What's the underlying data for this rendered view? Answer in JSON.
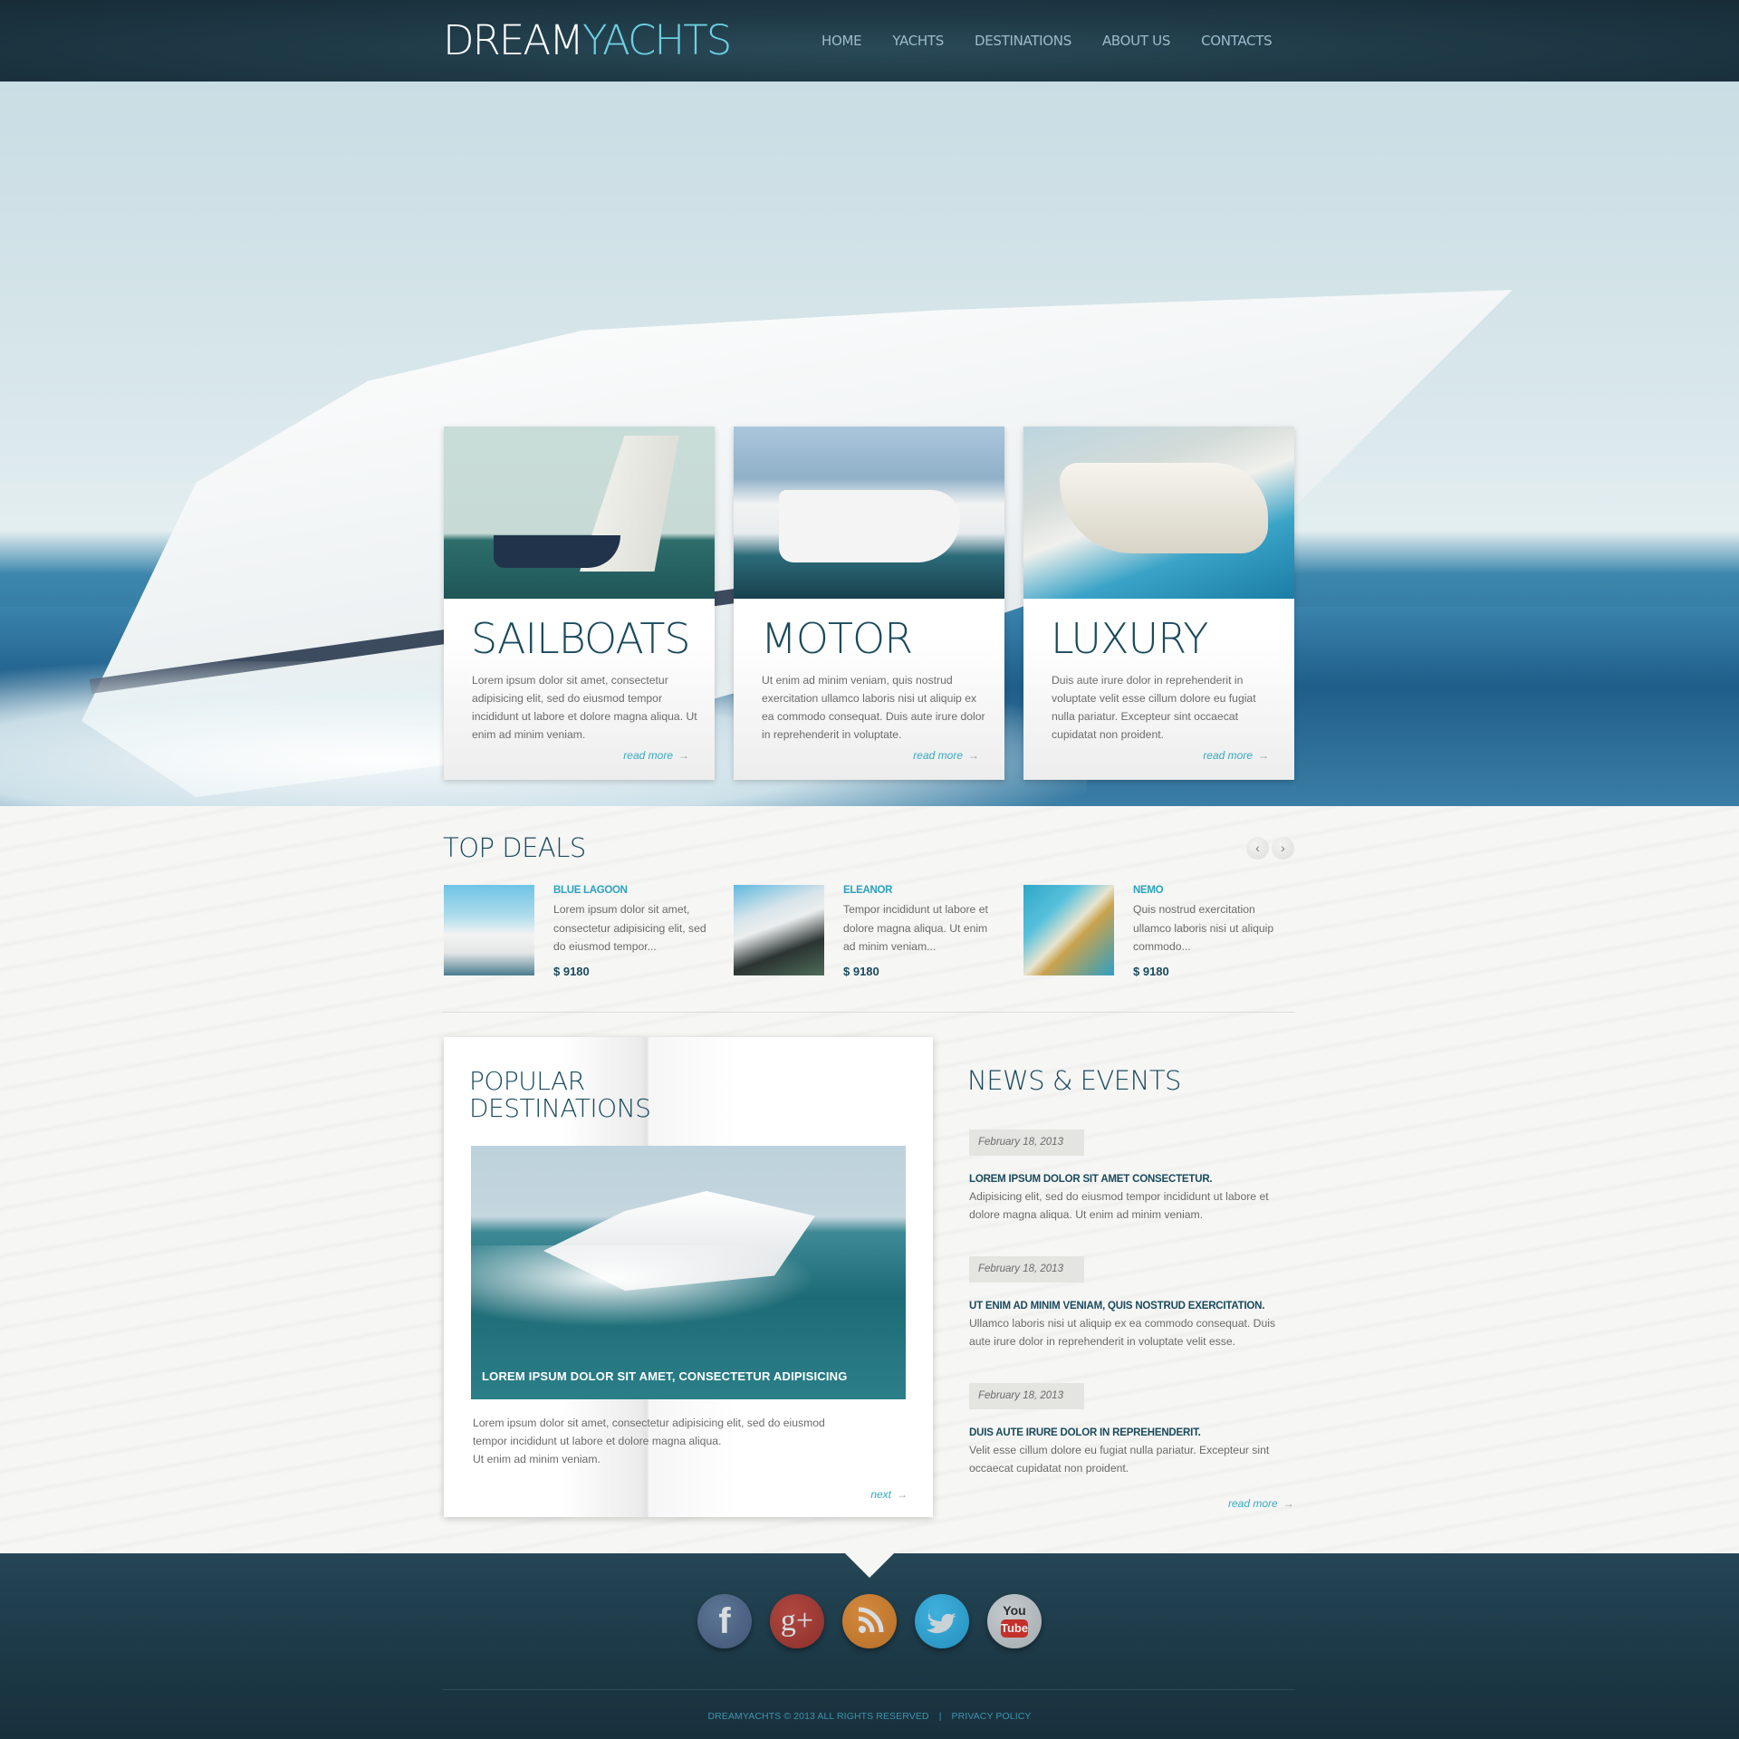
{
  "header": {
    "logo_part1": "DREAM",
    "logo_part2": "YACHTS",
    "nav": [
      "HOME",
      "YACHTS",
      "DESTINATIONS",
      "ABOUT US",
      "CONTACTS"
    ]
  },
  "categories": [
    {
      "title": "SAILBOATS",
      "text": "Lorem ipsum dolor sit amet, consectetur adipisicing elit, sed do eiusmod tempor incididunt ut labore et dolore magna aliqua. Ut enim ad minim veniam.",
      "link": "read more",
      "arrow": "→"
    },
    {
      "title": "MOTOR",
      "text": "Ut enim ad minim veniam, quis nostrud exercitation ullamco laboris nisi ut aliquip ex ea commodo consequat. Duis aute irure dolor in reprehenderit in voluptate.",
      "link": "read more",
      "arrow": "→"
    },
    {
      "title": "LUXURY",
      "text": "Duis aute irure dolor in reprehenderit in voluptate velit esse cillum dolore eu fugiat nulla pariatur. Excepteur sint occaecat cupidatat non proident.",
      "link": "read more",
      "arrow": "→"
    }
  ],
  "top_deals": {
    "title": "TOP DEALS",
    "prev": "‹",
    "next": "›",
    "items": [
      {
        "name": "BLUE LAGOON",
        "desc": "Lorem ipsum dolor sit amet, consectetur adipisicing elit, sed do eiusmod tempor...",
        "price": "$ 9180"
      },
      {
        "name": "ELEANOR",
        "desc": "Tempor incididunt ut labore et dolore magna aliqua. Ut enim ad minim veniam...",
        "price": "$ 9180"
      },
      {
        "name": "NEMO",
        "desc": "Quis nostrud exercitation ullamco laboris nisi ut aliquip commodo...",
        "price": "$ 9180"
      }
    ]
  },
  "popular": {
    "title_line1": "POPULAR",
    "title_line2": "DESTINATIONS",
    "caption": "LOREM IPSUM DOLOR SIT AMET, CONSECTETUR ADIPISICING",
    "text_line1": "Lorem ipsum dolor sit amet, consectetur adipisicing elit, sed do eiusmod",
    "text_line2": "tempor incididunt ut labore et dolore magna aliqua.",
    "text_line3": "Ut enim ad minim veniam.",
    "next": "next",
    "arrow": "→"
  },
  "news": {
    "title": "NEWS & EVENTS",
    "items": [
      {
        "date": "February 18, 2013",
        "headline": "LOREM IPSUM DOLOR SIT AMET CONSECTETUR.",
        "body": "Adipisicing elit, sed do eiusmod tempor incididunt ut labore et dolore magna aliqua. Ut enim ad minim veniam."
      },
      {
        "date": "February 18, 2013",
        "headline": "UT ENIM AD MINIM VENIAM, QUIS NOSTRUD EXERCITATION.",
        "body": "Ullamco laboris nisi ut aliquip ex ea commodo consequat. Duis aute irure dolor in reprehenderit in voluptate velit esse."
      },
      {
        "date": "February 18, 2013",
        "headline": "DUIS AUTE IRURE DOLOR IN REPREHENDERIT.",
        "body": "Velit esse cillum dolore eu fugiat nulla pariatur. Excepteur sint occaecat cupidatat non proident."
      }
    ],
    "read_more": "read more",
    "arrow": "→"
  },
  "footer": {
    "social": [
      {
        "name": "facebook",
        "glyph": "f"
      },
      {
        "name": "google-plus",
        "glyph": "g+"
      },
      {
        "name": "rss",
        "glyph": ""
      },
      {
        "name": "twitter",
        "glyph": ""
      },
      {
        "name": "youtube",
        "glyph_top": "You",
        "glyph_bottom": "Tube"
      }
    ],
    "copyright": "DREAMYACHTS © 2013 ALL RIGHTS RESERVED",
    "separator": "|",
    "privacy": "PRIVACY POLICY"
  }
}
